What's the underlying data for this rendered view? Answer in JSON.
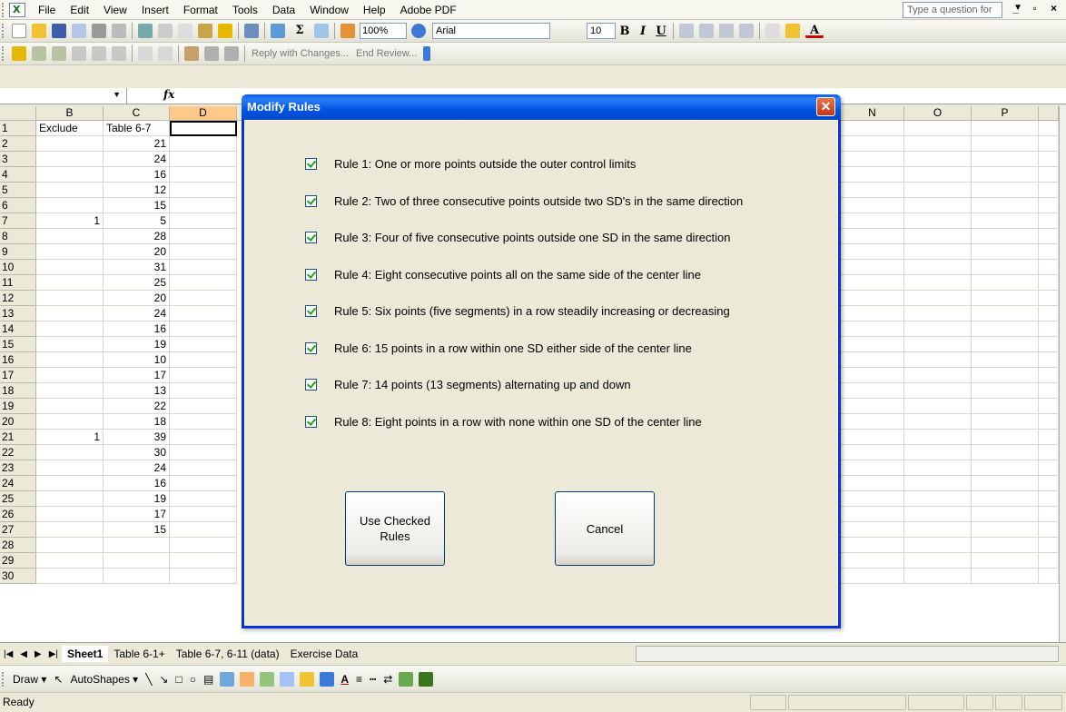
{
  "menubar": {
    "items": [
      "File",
      "Edit",
      "View",
      "Insert",
      "Format",
      "Tools",
      "Data",
      "Window",
      "Help",
      "Adobe PDF"
    ],
    "help_placeholder": "Type a question for help"
  },
  "toolbar": {
    "zoom": "100%",
    "font_name": "Arial",
    "font_size": "10",
    "reply_with_changes": "Reply with Changes...",
    "end_review": "End Review..."
  },
  "formula_bar": {
    "name_box": "",
    "fx": "fx",
    "content": ""
  },
  "grid": {
    "columns": [
      "B",
      "C",
      "D",
      "N",
      "O",
      "P"
    ],
    "row_numbers": [
      "1",
      "2",
      "3",
      "4",
      "5",
      "6",
      "7",
      "8",
      "9",
      "10",
      "11",
      "12",
      "13",
      "14",
      "15",
      "16",
      "17",
      "18",
      "19",
      "20",
      "21",
      "22",
      "23",
      "24",
      "25",
      "26",
      "27",
      "28",
      "29",
      "30"
    ],
    "col_b": [
      "Exclude",
      "",
      "",
      "",
      "",
      "",
      "1",
      "",
      "",
      "",
      "",
      "",
      "",
      "",
      "",
      "",
      "",
      "",
      "",
      "",
      "1",
      "",
      "",
      "",
      "",
      "",
      "",
      "",
      "",
      ""
    ],
    "col_c": [
      "Table 6-7",
      "21",
      "24",
      "16",
      "12",
      "15",
      "5",
      "28",
      "20",
      "31",
      "25",
      "20",
      "24",
      "16",
      "19",
      "10",
      "17",
      "13",
      "22",
      "18",
      "39",
      "30",
      "24",
      "16",
      "19",
      "17",
      "15",
      "",
      "",
      ""
    ]
  },
  "sheet_tabs": [
    "Sheet1",
    "Table 6-1+",
    "Table 6-7, 6-11 (data)",
    "Exercise Data"
  ],
  "drawbar": {
    "draw": "Draw",
    "autoshapes": "AutoShapes"
  },
  "status": "Ready",
  "dialog": {
    "title": "Modify Rules",
    "rules": [
      {
        "label": "Rule 1: One or more points outside the outer control limits",
        "checked": true
      },
      {
        "label": "Rule 2: Two of three consecutive points outside two SD's in the same direction",
        "checked": true
      },
      {
        "label": "Rule 3: Four of five consecutive points outside one SD in the same direction",
        "checked": true
      },
      {
        "label": "Rule 4: Eight consecutive points all on the same side of the center line",
        "checked": true
      },
      {
        "label": "Rule 5: Six points (five segments) in a row steadily increasing or decreasing",
        "checked": true
      },
      {
        "label": "Rule 6: 15 points in a row within one SD either side of the center line",
        "checked": true
      },
      {
        "label": "Rule 7: 14 points (13 segments) alternating up and down",
        "checked": true
      },
      {
        "label": "Rule 8: Eight points in a row with none within one SD of the center line",
        "checked": true
      }
    ],
    "use_checked_label": "Use Checked Rules",
    "cancel_label": "Cancel"
  },
  "colors": {
    "title_bar": "#0054e3",
    "dialog_bg": "#ece9d8",
    "check_color": "#21a121"
  }
}
